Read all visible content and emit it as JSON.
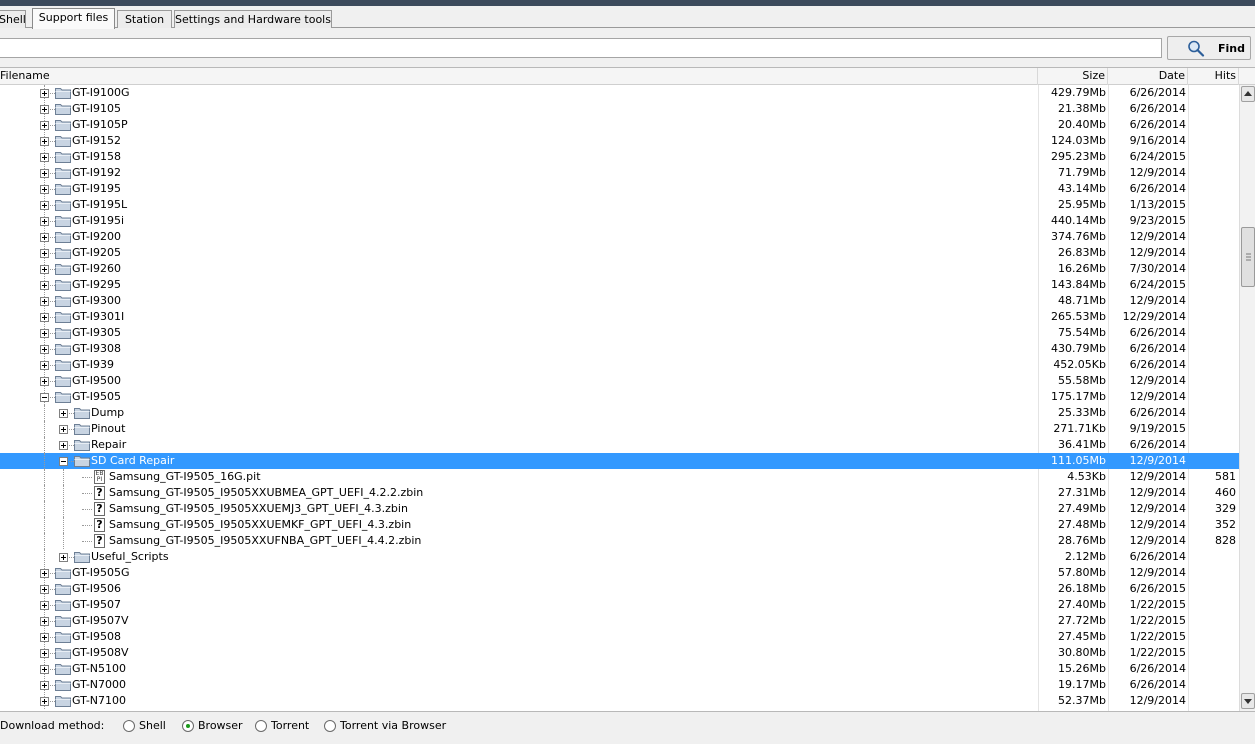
{
  "tabs": [
    {
      "label": "Shell",
      "active": false
    },
    {
      "label": "Support files",
      "active": true
    },
    {
      "label": "Station",
      "active": false
    },
    {
      "label": "Settings and Hardware tools",
      "active": false
    }
  ],
  "search": {
    "value": "",
    "find_label": "Find"
  },
  "columns": {
    "filename": "Filename",
    "size": "Size",
    "date": "Date",
    "hits": "Hits"
  },
  "rows": [
    {
      "name": "GT-I9100G",
      "size": "429.79Mb",
      "date": "6/26/2014",
      "hits": "",
      "level": 0,
      "type": "folder",
      "expanded": false
    },
    {
      "name": "GT-I9105",
      "size": "21.38Mb",
      "date": "6/26/2014",
      "hits": "",
      "level": 0,
      "type": "folder",
      "expanded": false
    },
    {
      "name": "GT-I9105P",
      "size": "20.40Mb",
      "date": "6/26/2014",
      "hits": "",
      "level": 0,
      "type": "folder",
      "expanded": false
    },
    {
      "name": "GT-I9152",
      "size": "124.03Mb",
      "date": "9/16/2014",
      "hits": "",
      "level": 0,
      "type": "folder",
      "expanded": false
    },
    {
      "name": "GT-I9158",
      "size": "295.23Mb",
      "date": "6/24/2015",
      "hits": "",
      "level": 0,
      "type": "folder",
      "expanded": false
    },
    {
      "name": "GT-I9192",
      "size": "71.79Mb",
      "date": "12/9/2014",
      "hits": "",
      "level": 0,
      "type": "folder",
      "expanded": false
    },
    {
      "name": "GT-I9195",
      "size": "43.14Mb",
      "date": "6/26/2014",
      "hits": "",
      "level": 0,
      "type": "folder",
      "expanded": false
    },
    {
      "name": "GT-I9195L",
      "size": "25.95Mb",
      "date": "1/13/2015",
      "hits": "",
      "level": 0,
      "type": "folder",
      "expanded": false
    },
    {
      "name": "GT-I9195i",
      "size": "440.14Mb",
      "date": "9/23/2015",
      "hits": "",
      "level": 0,
      "type": "folder",
      "expanded": false
    },
    {
      "name": "GT-I9200",
      "size": "374.76Mb",
      "date": "12/9/2014",
      "hits": "",
      "level": 0,
      "type": "folder",
      "expanded": false
    },
    {
      "name": "GT-I9205",
      "size": "26.83Mb",
      "date": "12/9/2014",
      "hits": "",
      "level": 0,
      "type": "folder",
      "expanded": false
    },
    {
      "name": "GT-I9260",
      "size": "16.26Mb",
      "date": "7/30/2014",
      "hits": "",
      "level": 0,
      "type": "folder",
      "expanded": false
    },
    {
      "name": "GT-I9295",
      "size": "143.84Mb",
      "date": "6/24/2015",
      "hits": "",
      "level": 0,
      "type": "folder",
      "expanded": false
    },
    {
      "name": "GT-I9300",
      "size": "48.71Mb",
      "date": "12/9/2014",
      "hits": "",
      "level": 0,
      "type": "folder",
      "expanded": false
    },
    {
      "name": "GT-I9301I",
      "size": "265.53Mb",
      "date": "12/29/2014",
      "hits": "",
      "level": 0,
      "type": "folder",
      "expanded": false
    },
    {
      "name": "GT-I9305",
      "size": "75.54Mb",
      "date": "6/26/2014",
      "hits": "",
      "level": 0,
      "type": "folder",
      "expanded": false
    },
    {
      "name": "GT-I9308",
      "size": "430.79Mb",
      "date": "6/26/2014",
      "hits": "",
      "level": 0,
      "type": "folder",
      "expanded": false
    },
    {
      "name": "GT-I939",
      "size": "452.05Kb",
      "date": "6/26/2014",
      "hits": "",
      "level": 0,
      "type": "folder",
      "expanded": false
    },
    {
      "name": "GT-I9500",
      "size": "55.58Mb",
      "date": "12/9/2014",
      "hits": "",
      "level": 0,
      "type": "folder",
      "expanded": false
    },
    {
      "name": "GT-I9505",
      "size": "175.17Mb",
      "date": "12/9/2014",
      "hits": "",
      "level": 0,
      "type": "folder",
      "expanded": true
    },
    {
      "name": "Dump",
      "size": "25.33Mb",
      "date": "6/26/2014",
      "hits": "",
      "level": 1,
      "type": "folder",
      "expanded": false
    },
    {
      "name": "Pinout",
      "size": "271.71Kb",
      "date": "9/19/2015",
      "hits": "",
      "level": 1,
      "type": "folder",
      "expanded": false
    },
    {
      "name": "Repair",
      "size": "36.41Mb",
      "date": "6/26/2014",
      "hits": "",
      "level": 1,
      "type": "folder",
      "expanded": false
    },
    {
      "name": "SD Card Repair",
      "size": "111.05Mb",
      "date": "12/9/2014",
      "hits": "",
      "level": 1,
      "type": "folder",
      "expanded": true,
      "selected": true
    },
    {
      "name": "Samsung_GT-I9505_16G.pit",
      "size": "4.53Kb",
      "date": "12/9/2014",
      "hits": "581",
      "level": 2,
      "type": "pit"
    },
    {
      "name": "Samsung_GT-I9505_I9505XXUBMEA_GPT_UEFI_4.2.2.zbin",
      "size": "27.31Mb",
      "date": "12/9/2014",
      "hits": "460",
      "level": 2,
      "type": "unknown"
    },
    {
      "name": "Samsung_GT-I9505_I9505XXUEMJ3_GPT_UEFI_4.3.zbin",
      "size": "27.49Mb",
      "date": "12/9/2014",
      "hits": "329",
      "level": 2,
      "type": "unknown"
    },
    {
      "name": "Samsung_GT-I9505_I9505XXUEMKF_GPT_UEFI_4.3.zbin",
      "size": "27.48Mb",
      "date": "12/9/2014",
      "hits": "352",
      "level": 2,
      "type": "unknown"
    },
    {
      "name": "Samsung_GT-I9505_I9505XXUFNBA_GPT_UEFI_4.4.2.zbin",
      "size": "28.76Mb",
      "date": "12/9/2014",
      "hits": "828",
      "level": 2,
      "type": "unknown"
    },
    {
      "name": "Useful_Scripts",
      "size": "2.12Mb",
      "date": "6/26/2014",
      "hits": "",
      "level": 1,
      "type": "folder",
      "expanded": false
    },
    {
      "name": "GT-I9505G",
      "size": "57.80Mb",
      "date": "12/9/2014",
      "hits": "",
      "level": 0,
      "type": "folder",
      "expanded": false
    },
    {
      "name": "GT-I9506",
      "size": "26.18Mb",
      "date": "6/26/2015",
      "hits": "",
      "level": 0,
      "type": "folder",
      "expanded": false
    },
    {
      "name": "GT-I9507",
      "size": "27.40Mb",
      "date": "1/22/2015",
      "hits": "",
      "level": 0,
      "type": "folder",
      "expanded": false
    },
    {
      "name": "GT-I9507V",
      "size": "27.72Mb",
      "date": "1/22/2015",
      "hits": "",
      "level": 0,
      "type": "folder",
      "expanded": false
    },
    {
      "name": "GT-I9508",
      "size": "27.45Mb",
      "date": "1/22/2015",
      "hits": "",
      "level": 0,
      "type": "folder",
      "expanded": false
    },
    {
      "name": "GT-I9508V",
      "size": "30.80Mb",
      "date": "1/22/2015",
      "hits": "",
      "level": 0,
      "type": "folder",
      "expanded": false
    },
    {
      "name": "GT-N5100",
      "size": "15.26Mb",
      "date": "6/26/2014",
      "hits": "",
      "level": 0,
      "type": "folder",
      "expanded": false
    },
    {
      "name": "GT-N7000",
      "size": "19.17Mb",
      "date": "6/26/2014",
      "hits": "",
      "level": 0,
      "type": "folder",
      "expanded": false
    },
    {
      "name": "GT-N7100",
      "size": "52.37Mb",
      "date": "12/9/2014",
      "hits": "",
      "level": 0,
      "type": "folder",
      "expanded": false
    }
  ],
  "footer": {
    "label": "Download method:",
    "options": [
      {
        "label": "Shell",
        "selected": false
      },
      {
        "label": "Browser",
        "selected": true
      },
      {
        "label": "Torrent",
        "selected": false
      },
      {
        "label": "Torrent via Browser",
        "selected": false
      }
    ]
  },
  "colors": {
    "selection": "#3399ff",
    "folder": "#c8d4e2",
    "titlebar": "#3c4a5c",
    "radio_on": "#1a9a1a"
  },
  "icons": {
    "find": "magnifier-icon",
    "folder": "folder-icon",
    "file_pit": "pit-file-icon",
    "file_unknown": "unknown-file-icon"
  }
}
